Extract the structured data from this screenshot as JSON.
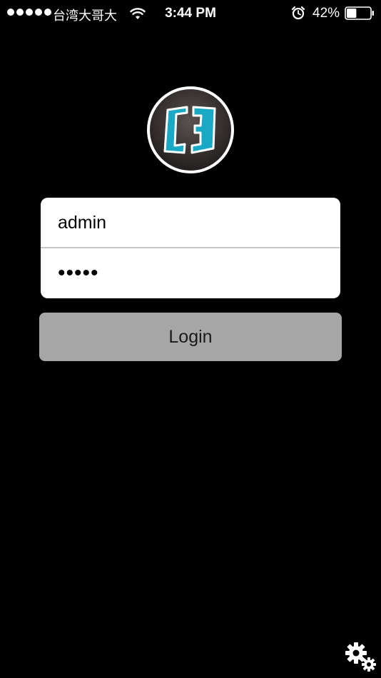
{
  "status_bar": {
    "carrier": "台湾大哥大",
    "time": "3:44 PM",
    "battery_percent": "42%",
    "battery_level": 0.42,
    "signal_dots": 5,
    "icons": [
      "wifi-icon",
      "alarm-icon",
      "battery-icon"
    ]
  },
  "login": {
    "username_value": "admin",
    "password_value": "•••••",
    "button_label": "Login"
  },
  "colors": {
    "background": "#000000",
    "logo_accent": "#1aa9c4",
    "card": "#ffffff",
    "button": "#a6a6a6"
  },
  "icons": {
    "logo": "app-logo",
    "settings": "gears-icon"
  }
}
